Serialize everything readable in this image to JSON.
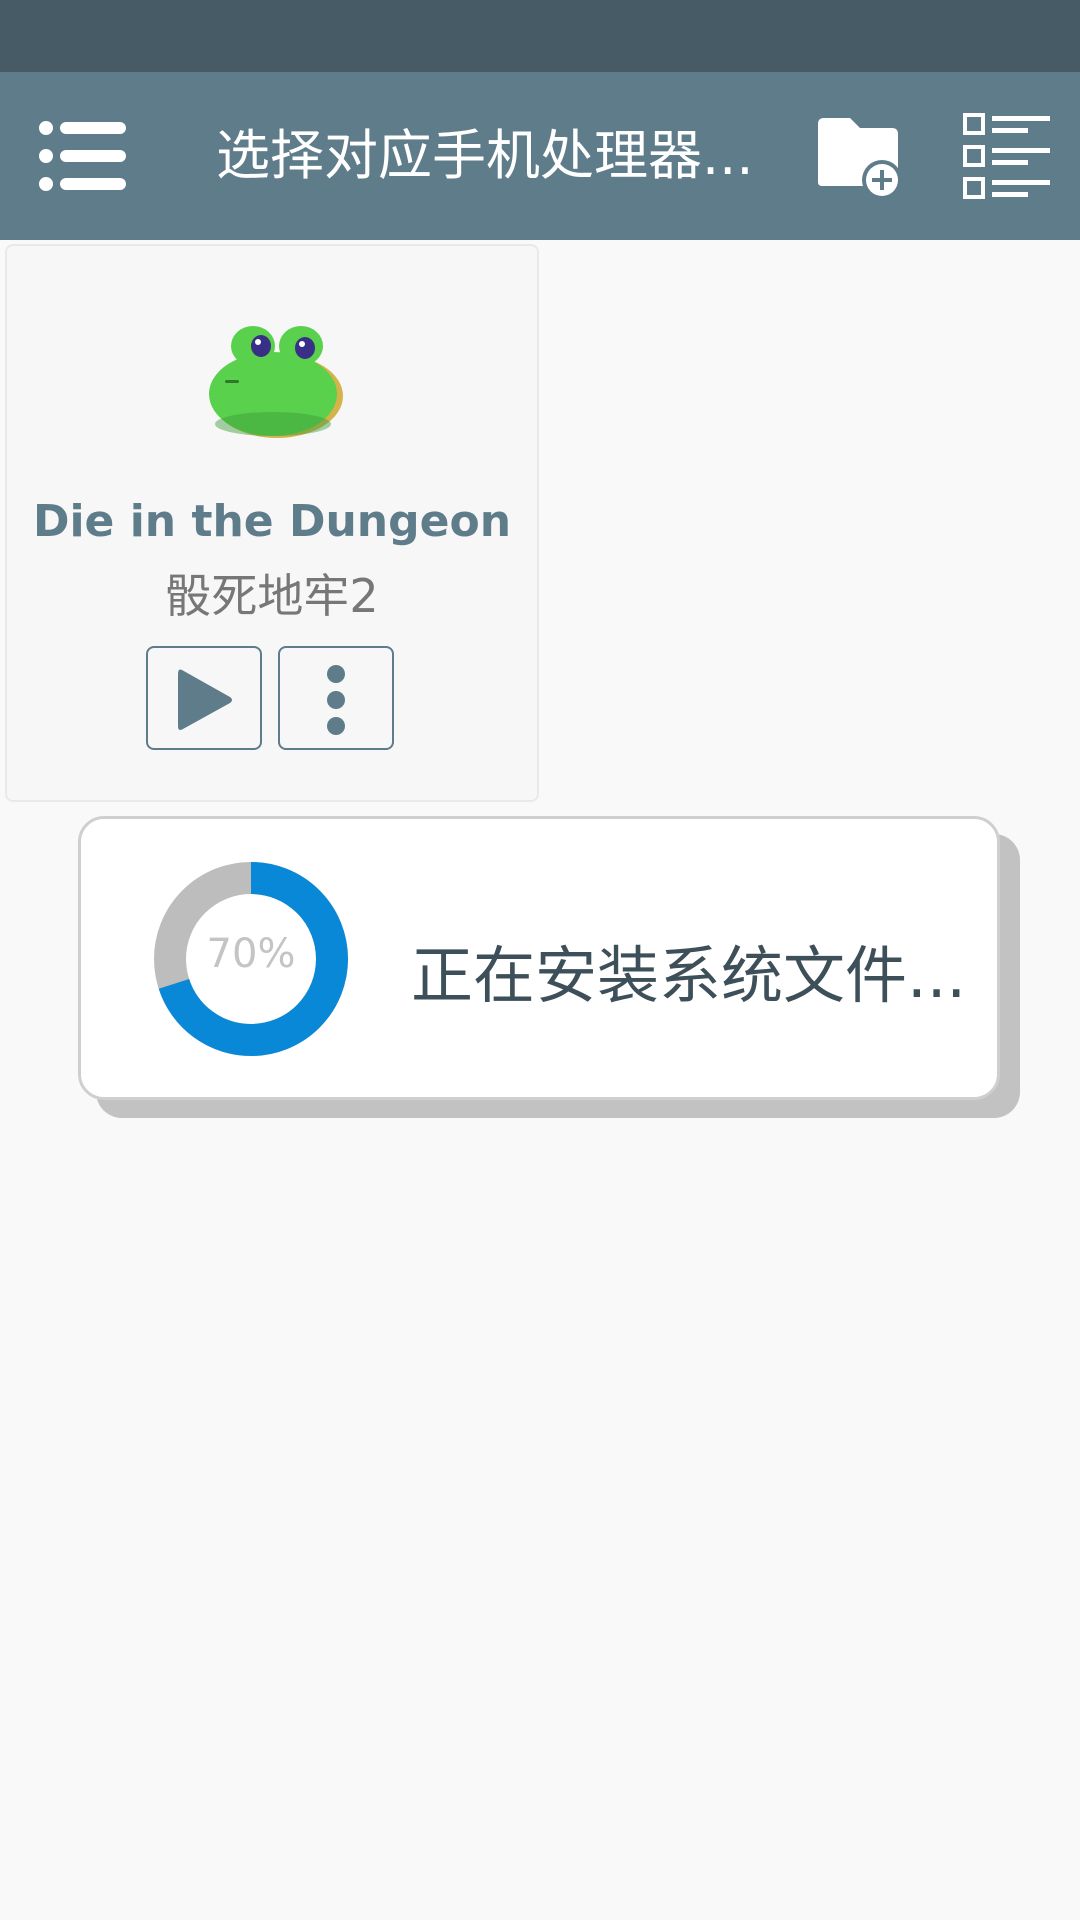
{
  "toolbar": {
    "title": "选择对应手机处理器...",
    "icons": [
      "menu-icon",
      "folder-add-icon",
      "list-grid-icon"
    ]
  },
  "game_card": {
    "title": "Die in the Dungeon",
    "subtitle": "骰死地牢2",
    "icon": "frog-icon",
    "actions": [
      "play-icon",
      "more-vertical-icon"
    ]
  },
  "install_dialog": {
    "progress_text": "70%",
    "progress": 0.7,
    "message": "正在安装系统文件...",
    "ring_color": "#0a88d8",
    "track_color": "#bdbdbd"
  },
  "colors": {
    "status_bar": "#465b66",
    "toolbar": "#5f7c8a",
    "accent": "#5f7c8a"
  }
}
